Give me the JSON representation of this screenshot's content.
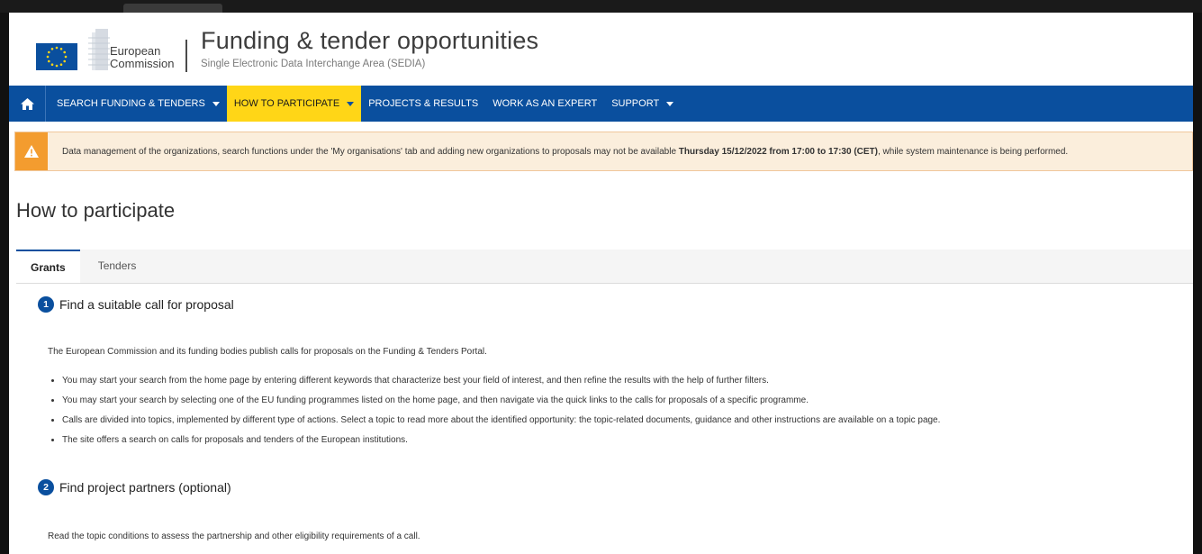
{
  "header": {
    "org_line1": "European",
    "org_line2": "Commission",
    "title": "Funding & tender opportunities",
    "subtitle": "Single Electronic Data Interchange Area (SEDIA)"
  },
  "nav": {
    "items": [
      {
        "label": "SEARCH FUNDING & TENDERS",
        "dropdown": true
      },
      {
        "label": "HOW TO PARTICIPATE",
        "dropdown": true,
        "active": true
      },
      {
        "label": "PROJECTS & RESULTS",
        "dropdown": false
      },
      {
        "label": "WORK AS AN EXPERT",
        "dropdown": false
      },
      {
        "label": "SUPPORT",
        "dropdown": true
      }
    ]
  },
  "alert": {
    "text_before": "Data management of the organizations, search functions under the 'My organisations' tab and adding new organizations to proposals may not be available ",
    "text_bold": "Thursday 15/12/2022 from 17:00 to 17:30 (CET)",
    "text_after": ", while system maintenance is being performed."
  },
  "page_title": "How to participate",
  "tabs": [
    {
      "label": "Grants",
      "active": true
    },
    {
      "label": "Tenders",
      "active": false
    }
  ],
  "steps": [
    {
      "number": "1",
      "title": "Find a suitable call for proposal",
      "intro": "The European Commission and its funding bodies publish calls for proposals on the Funding & Tenders Portal.",
      "bullets": [
        "You may start your search from the home page by entering different keywords that characterize best your field of interest, and then refine the results with the help of further filters.",
        "You may start your search by selecting one of the EU funding programmes listed on the home page, and then navigate via the quick links to the calls for proposals of a specific programme.",
        "Calls are divided into topics, implemented by different type of actions. Select a topic to read more about the identified opportunity: the topic-related documents, guidance and other instructions are available on a topic page.",
        "The site offers a search on calls for proposals and tenders of the European institutions."
      ]
    },
    {
      "number": "2",
      "title": "Find project partners (optional)",
      "intro": "Read the topic conditions to assess the partnership and other eligibility requirements of a call."
    }
  ],
  "colors": {
    "nav_blue": "#0a4f9e",
    "nav_active_yellow": "#ffd617",
    "alert_orange": "#f39c2f",
    "alert_bg": "#fbeedc"
  }
}
